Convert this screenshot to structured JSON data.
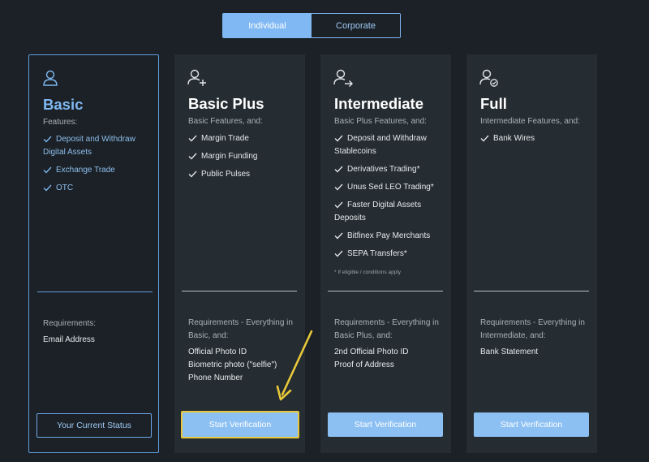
{
  "tabs": [
    {
      "label": "Individual",
      "active": true
    },
    {
      "label": "Corporate",
      "active": false
    }
  ],
  "cards": [
    {
      "icon": "user-icon",
      "title": "Basic",
      "subtitle": "Features:",
      "features": [
        "Deposit and Withdraw Digital Assets",
        "Exchange Trade",
        "OTC"
      ],
      "footnote": "",
      "requirements_label": "Requirements:",
      "requirements": [
        "Email Address"
      ],
      "button_label": "Your Current Status"
    },
    {
      "icon": "user-plus-icon",
      "title": "Basic Plus",
      "subtitle": "Basic Features, and:",
      "features": [
        "Margin Trade",
        "Margin Funding",
        "Public Pulses"
      ],
      "footnote": "",
      "requirements_label": "Requirements - Everything in Basic, and:",
      "requirements": [
        "Official Photo ID",
        "Biometric photo (\"selfie\")",
        "Phone Number"
      ],
      "button_label": "Start Verification"
    },
    {
      "icon": "user-arrow-icon",
      "title": "Intermediate",
      "subtitle": "Basic Plus Features, and:",
      "features": [
        "Deposit and Withdraw Stablecoins",
        "Derivatives Trading*",
        "Unus Sed LEO Trading*",
        "Faster Digital Assets Deposits",
        "Bitfinex Pay Merchants",
        "SEPA Transfers*"
      ],
      "footnote": "* If eligible / conditions apply",
      "requirements_label": "Requirements - Everything in Basic Plus, and:",
      "requirements": [
        "2nd Official Photo ID",
        "Proof of Address"
      ],
      "button_label": "Start Verification"
    },
    {
      "icon": "user-check-icon",
      "title": "Full",
      "subtitle": "Intermediate Features, and:",
      "features": [
        "Bank Wires"
      ],
      "footnote": "",
      "requirements_label": "Requirements - Everything in Intermediate, and:",
      "requirements": [
        "Bank Statement"
      ],
      "button_label": "Start Verification"
    }
  ],
  "colors": {
    "background": "#1b2126",
    "card": "#252d32",
    "accent": "#7fb8f2",
    "highlight": "#e8c83a"
  }
}
